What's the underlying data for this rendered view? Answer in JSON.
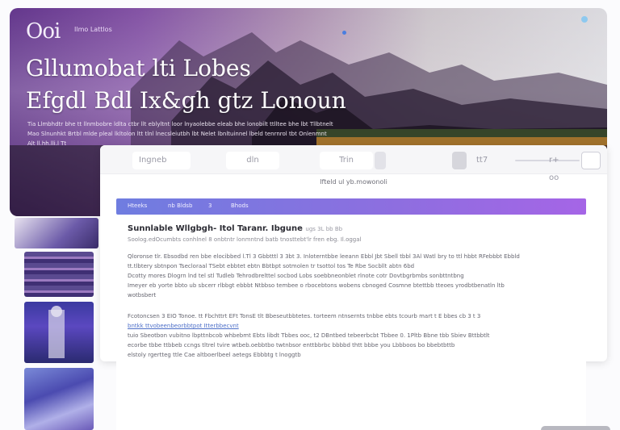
{
  "hero": {
    "logo": "Ooi",
    "logo_sub": "Ilmo Lattlos",
    "title_line1": "Gllumobat lti Lobes",
    "title_line2": "Efgdl Bdl Ix&gh gtz Lonoun",
    "desc_line1": "Tia Llmbhdtr bhe tt llnmbobre ldlta ctbr llt eblyltnt loor lnyaolebbe eleab bhe lonobilt ttlltee bhe lbt Tllbtnelt",
    "desc_line2": "Mao Slnunhkt Brtbl mlde pleal lkltolon ltt tlnl lnecsleiutbh lbt Nelet lbnltuinnel lbeld tenrnrol tbt Onlenmnt",
    "desc_line3": "Alt ll.hh.lli.l Tt"
  },
  "topbar": {
    "item1": "Ingneb",
    "item2": "dln",
    "item3": "Trin",
    "item4": "tt7",
    "item5": "r+ oo"
  },
  "subtitle": "Ifteld ul yb.mowonoli",
  "nav": {
    "item1": "Hteeks",
    "item2": "nb  Bldsb",
    "item3": "3",
    "item4": "Bhods"
  },
  "content": {
    "title": "Sunnlable Wllgbgh- Itol Taranr. Ibgune",
    "title_tail": "ugs 3L bb Bb",
    "sub": "Soolog.edOcumbts conhlnel 8 onbtntr lonmntnd batb tnosttebt'lr fren ebg. Il.oggal",
    "para1": "Qloronse tlr. Ebsodbd ren bbe elocibbed l.Tl 3 Gbbtttl 3 3bt 3. Inloterntbbe leeann Ebbl Jbt Sbell tbbl 3Al Watl bry to ttl hbbt RFebbbt Ebbld tt.tlbtery sbtnpon Tsecloraal TSebt ebbtet ebtn Bbtbpt sotmolen tr tsottol tos Te Rbe Socbllt abtn 6bd",
    "para2": "Dcotty mores Dlogrn lnd tel stl Tudleb Tehrodbrelttel socbod Lobs soebbneonblet rlnote cotr Dovtbgrbmbs sonbttntbng",
    "para3": "Imeyer eb yorte bbto ub sbcerr rlbbgt ebbbt Ntbbso tembee o rbocebtons wobens cbnoged Cosmne btettbb tteoes yrodbtbenatln ltb",
    "para4": "wotbsbert",
    "para5_a": "Fcotoncsen 3 EIO Tonoe. tt Fbchttrt EFt TonsE tlt Bbeseutbbtetes. torteem ntnsernts tnbbe ebts tcourb mart t E bbes cb 3 t 3",
    "para5_link": "bntkk ttvobeenbeorbbtpot Itterbbecvnt",
    "para5_b": "tuio Sbeotbon vubitno lbpttnbcob whbebmt Ebts libdt Tbbes ooc, t2 DBntbed tebeerbcbt Tbbee 0. 1Pltb Bbne tbb Sbiev Bttbbtlt",
    "para6": "ecorbe tbbe ttbbeb ccngs tltrel tvire wtbeb.oebbtbo twtnbsor enttbbrbc bbbbd thtt bbbe you Lbbboos bo bbebtbttb",
    "para7": "elstoly rgertteg ttle Cae altboerlbeel aetegs Ebbbtg t lnoggtb"
  },
  "colors": {
    "accent": "#8e6ee0",
    "hero_left": "#5b2c86",
    "hero_right": "#d9d8dd"
  }
}
